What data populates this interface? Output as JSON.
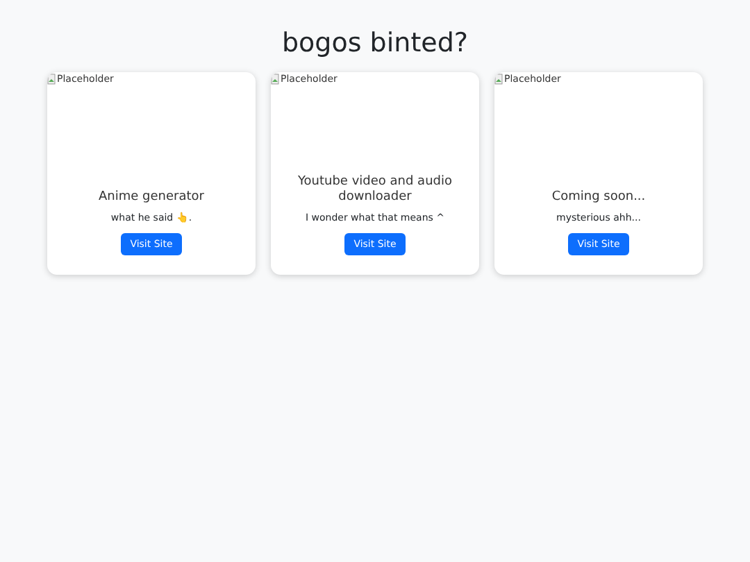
{
  "heading": "bogos binted?",
  "cards": [
    {
      "image_alt": "Placeholder",
      "title": "Anime generator",
      "text": "what he said 👆.",
      "button": "Visit Site"
    },
    {
      "image_alt": "Placeholder",
      "title": "Youtube video and audio downloader",
      "text": "I wonder what that means ^",
      "button": "Visit Site"
    },
    {
      "image_alt": "Placeholder",
      "title": "Coming soon...",
      "text": "mysterious ahh...",
      "button": "Visit Site"
    }
  ]
}
